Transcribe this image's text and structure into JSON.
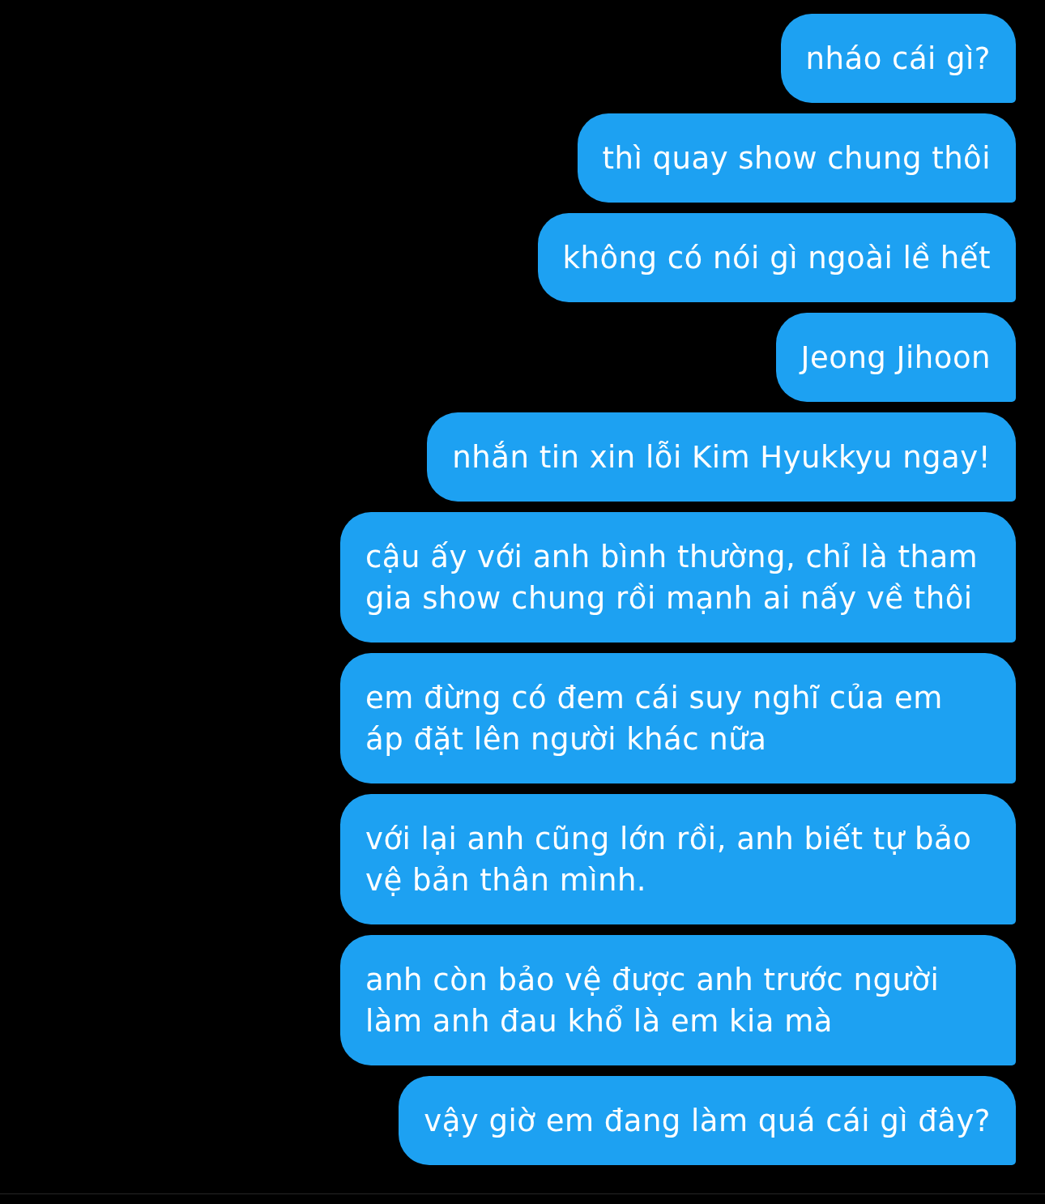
{
  "messages": [
    {
      "text": "nháo cái gì?"
    },
    {
      "text": "thì quay show chung thôi"
    },
    {
      "text": "không có nói gì ngoài lề hết"
    },
    {
      "text": "Jeong Jihoon"
    },
    {
      "text": "nhắn tin xin lỗi Kim Hyukkyu ngay!"
    },
    {
      "text": "cậu ấy với anh bình thường, chỉ là tham gia show chung rồi mạnh ai nấy về thôi"
    },
    {
      "text": "em đừng có đem cái suy nghĩ của em áp đặt lên người khác nữa"
    },
    {
      "text": "với lại anh cũng lớn rồi, anh biết tự bảo vệ bản thân mình."
    },
    {
      "text": "anh còn bảo vệ được anh trước người làm anh đau khổ là em kia mà"
    },
    {
      "text": "vậy giờ em đang làm quá cái gì đây?"
    }
  ]
}
